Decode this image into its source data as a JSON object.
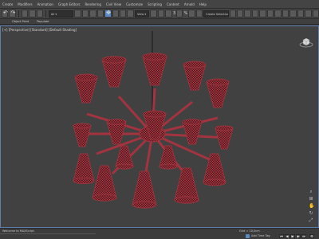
{
  "menubar": {
    "items": [
      "Create",
      "Modifiers",
      "Animation",
      "Graph Editors",
      "Rendering",
      "Civil View",
      "Customize",
      "Scripting",
      "Content",
      "Arnold",
      "Help"
    ]
  },
  "toolbar": {
    "selection_filter": "Create Selection Se",
    "snap_labels": [
      "3",
      "%"
    ]
  },
  "ribbon": {
    "tabs": [
      "",
      "Object Paint",
      "Populate"
    ]
  },
  "viewport": {
    "label": "[+] [Perspective] [Standard] [Default Shading]",
    "wire_color": "#a3343f",
    "background": "#414141"
  },
  "statusbar": {
    "left_text": "Welcome to MAXScript.",
    "selection_text": "",
    "grid_value": "Grid = 10,0cm",
    "add_time_tag": "Add Time Tag"
  }
}
